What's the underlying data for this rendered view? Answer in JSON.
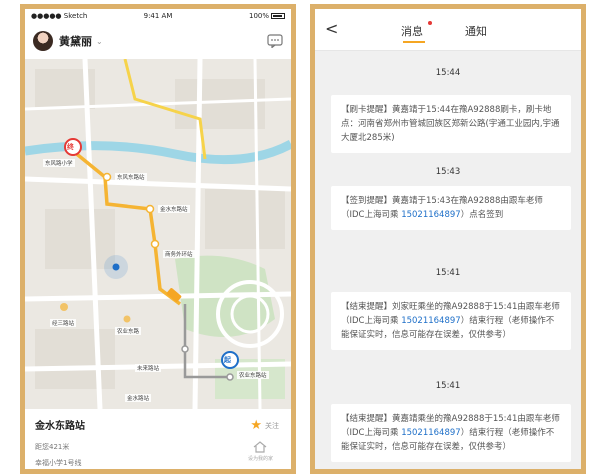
{
  "left": {
    "status": {
      "carrier": "●●●●● Sketch",
      "time": "9:41 AM",
      "battery": "100%"
    },
    "header": {
      "username": "黄黛丽",
      "chevron": "⌄"
    },
    "map_labels": {
      "school": "东风路小学",
      "road1": "东风东路站",
      "road2": "金水东路站",
      "road3": "商务外环站",
      "road4": "经三路站",
      "road5": "农业东路",
      "road6": "未来路站",
      "road7": "金水路站",
      "road8": "农业东路站",
      "pin_end": "终",
      "pin_start": "起"
    },
    "bottom": {
      "station": "金水东路站",
      "distance": "距您421米",
      "school": "幸福小学1号线",
      "follow": "关注",
      "home_label": "设为我的家"
    }
  },
  "right": {
    "tabs": {
      "messages": "消息",
      "notices": "通知"
    },
    "messages": [
      {
        "time": "15:44",
        "pre": "【刷卡提醒】黄嘉靖于15:44在豫A92888刷卡，刷卡地点：河南省郑州市管城回族区郑新公路(宇通工业园内,宇通大厦北285米)",
        "phone": "",
        "post": ""
      },
      {
        "time": "15:43",
        "pre": "【签到提醒】黄嘉靖于15:43在豫A92888由跟车老师（IDC上海司乘 ",
        "phone": "15021164897",
        "post": "）点名签到"
      },
      {
        "time": "15:41",
        "pre": "【结束提醒】刘家旺乘坐的豫A92888于15:41由跟车老师（IDC上海司乘 ",
        "phone": "15021164897",
        "post": "）结束行程（老师操作不能保证实时，信息可能存在误差，仅供参考）"
      },
      {
        "time": "15:41",
        "pre": "【结束提醒】黄嘉靖乘坐的豫A92888于15:41由跟车老师（IDC上海司乘 ",
        "phone": "15021164897",
        "post": "）结束行程（老师操作不能保证实时，信息可能存在误差，仅供参考）"
      }
    ]
  },
  "colors": {
    "frame": "#dcb06a",
    "accent": "#f5a623",
    "link": "#1e6fc8",
    "route": "#f5b433",
    "pin_end": "#e53935",
    "pin_start": "#1e6fc8"
  }
}
